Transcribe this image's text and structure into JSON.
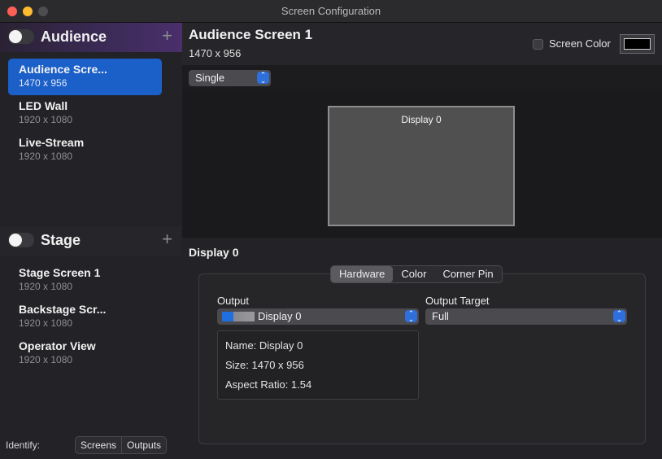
{
  "window": {
    "title": "Screen Configuration"
  },
  "sidebar": {
    "audience": {
      "title": "Audience",
      "screens": [
        {
          "name": "Audience Scre...",
          "resolution": "1470 x 956",
          "selected": true
        },
        {
          "name": "LED Wall",
          "resolution": "1920 x 1080"
        },
        {
          "name": "Live-Stream",
          "resolution": "1920 x 1080"
        }
      ]
    },
    "stage": {
      "title": "Stage",
      "screens": [
        {
          "name": "Stage Screen 1",
          "resolution": "1920 x 1080"
        },
        {
          "name": "Backstage Scr...",
          "resolution": "1920 x 1080"
        },
        {
          "name": "Operator View",
          "resolution": "1920 x 1080"
        }
      ]
    },
    "identify": {
      "label": "Identify:",
      "buttons": [
        "Screens",
        "Outputs"
      ]
    }
  },
  "main": {
    "title": "Audience Screen 1",
    "resolution": "1470 x 956",
    "screen_color_label": "Screen Color",
    "screen_color": "#000000",
    "mode": "Single",
    "preview": {
      "display_label": "Display 0"
    },
    "detail_title": "Display 0",
    "tabs": [
      "Hardware",
      "Color",
      "Corner Pin"
    ],
    "active_tab": "Hardware",
    "output": {
      "label": "Output",
      "value": "Display 0",
      "info": {
        "name": "Name:  Display 0",
        "size": "Size:  1470 x 956",
        "aspect": "Aspect Ratio:  1.54"
      }
    },
    "output_target": {
      "label": "Output Target",
      "value": "Full"
    }
  },
  "colors": {
    "accent": "#1b5fc8",
    "popup_chevron": "#2f6fdc"
  }
}
